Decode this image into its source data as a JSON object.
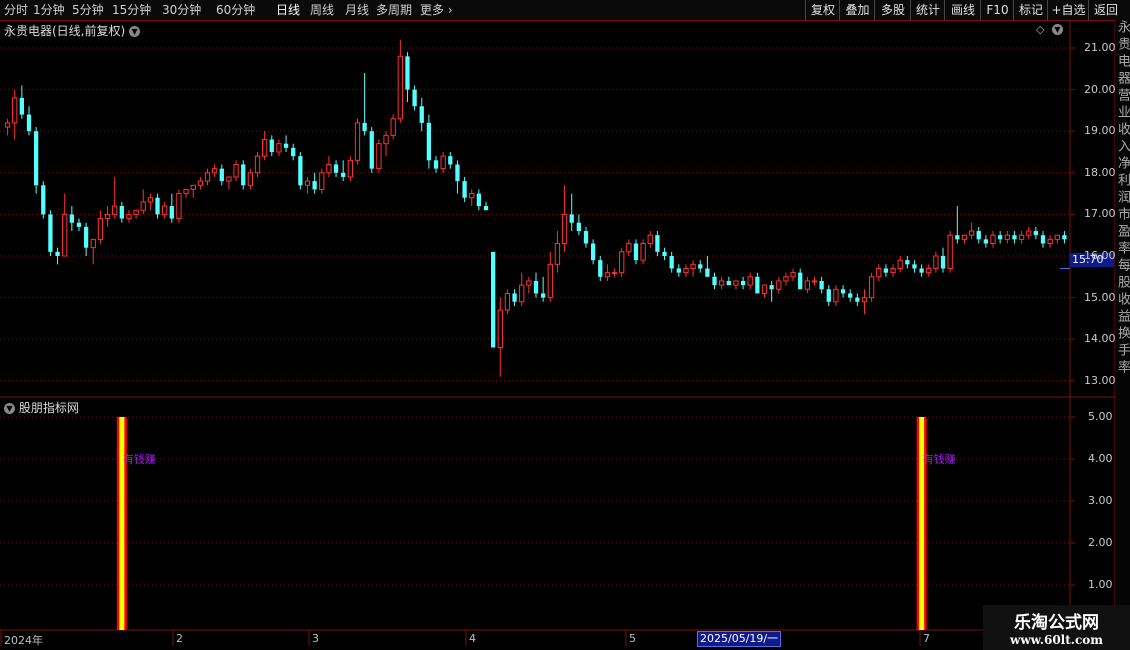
{
  "toolbar": {
    "periods": [
      "分时",
      "1分钟",
      "5分钟",
      "15分钟",
      "30分钟",
      "60分钟",
      "日线",
      "周线",
      "月线",
      "多周期",
      "更多"
    ],
    "active_period": "日线",
    "tools": [
      "复权",
      "叠加",
      "多股",
      "统计",
      "画线",
      "F10",
      "标记",
      "+自选",
      "返回"
    ]
  },
  "main_chart": {
    "title": "永贵电器(日线,前复权)",
    "price_axis": [
      "21.00",
      "20.00",
      "19.00",
      "18.00",
      "17.00",
      "16.00",
      "15.00",
      "14.00",
      "13.00"
    ],
    "current_price": "15.70"
  },
  "indicator": {
    "title": "股朋指标网",
    "axis": [
      "5.00",
      "4.00",
      "3.00",
      "2.00",
      "1.00"
    ],
    "signal_label": "有钱赚"
  },
  "x_axis": {
    "labels": [
      "2024年",
      "2",
      "3",
      "4",
      "5",
      "7"
    ],
    "crosshair_date": "2025/05/19/一"
  },
  "right_strip_text": "永贵电器营业收入净利润市盈率每股收益换手率",
  "watermark": {
    "line1": "乐淘公式网",
    "line2": "www.60lt.com"
  },
  "colors": {
    "up": "#ff3232",
    "down": "#54ffff",
    "grid": "#7a1010",
    "signal": "#ffff00",
    "signal_edge": "#ff0000"
  },
  "chart_data": {
    "type": "candlestick",
    "ylim": [
      12.8,
      21.3
    ],
    "candles": [
      [
        19.1,
        19.3,
        18.9,
        19.2
      ],
      [
        19.2,
        20.0,
        18.8,
        19.8
      ],
      [
        19.8,
        20.1,
        19.3,
        19.4
      ],
      [
        19.4,
        19.6,
        18.9,
        19.0
      ],
      [
        19.0,
        19.1,
        17.5,
        17.7
      ],
      [
        17.7,
        17.8,
        16.9,
        17.0
      ],
      [
        17.0,
        17.1,
        16.0,
        16.1
      ],
      [
        16.1,
        16.2,
        15.8,
        16.0
      ],
      [
        16.0,
        17.5,
        16.0,
        17.0
      ],
      [
        17.0,
        17.2,
        16.6,
        16.8
      ],
      [
        16.8,
        16.9,
        16.6,
        16.7
      ],
      [
        16.7,
        16.8,
        16.0,
        16.2
      ],
      [
        16.2,
        16.3,
        15.8,
        16.4
      ],
      [
        16.4,
        17.1,
        16.3,
        16.9
      ],
      [
        16.9,
        17.2,
        16.7,
        17.0
      ],
      [
        17.0,
        17.9,
        16.9,
        17.2
      ],
      [
        17.2,
        17.3,
        16.8,
        16.9
      ],
      [
        16.9,
        17.1,
        16.8,
        17.0
      ],
      [
        17.0,
        17.1,
        16.9,
        17.1
      ],
      [
        17.1,
        17.6,
        17.0,
        17.3
      ],
      [
        17.3,
        17.5,
        17.1,
        17.4
      ],
      [
        17.4,
        17.5,
        16.9,
        17.0
      ],
      [
        17.0,
        17.3,
        16.9,
        17.2
      ],
      [
        17.2,
        17.5,
        16.8,
        16.9
      ],
      [
        16.9,
        17.6,
        16.8,
        17.5
      ],
      [
        17.5,
        17.6,
        17.4,
        17.6
      ],
      [
        17.6,
        17.7,
        17.4,
        17.7
      ],
      [
        17.7,
        17.9,
        17.6,
        17.8
      ],
      [
        17.8,
        18.1,
        17.7,
        18.0
      ],
      [
        18.0,
        18.2,
        17.9,
        18.1
      ],
      [
        18.1,
        18.2,
        17.7,
        17.8
      ],
      [
        17.8,
        17.9,
        17.6,
        17.9
      ],
      [
        17.9,
        18.3,
        17.8,
        18.2
      ],
      [
        18.2,
        18.3,
        17.6,
        17.7
      ],
      [
        17.7,
        18.1,
        17.6,
        18.0
      ],
      [
        18.0,
        18.5,
        17.9,
        18.4
      ],
      [
        18.4,
        19.0,
        18.3,
        18.8
      ],
      [
        18.8,
        18.9,
        18.4,
        18.5
      ],
      [
        18.5,
        18.8,
        18.4,
        18.7
      ],
      [
        18.7,
        18.9,
        18.5,
        18.6
      ],
      [
        18.6,
        18.7,
        18.3,
        18.4
      ],
      [
        18.4,
        18.5,
        17.6,
        17.7
      ],
      [
        17.7,
        17.9,
        17.5,
        17.8
      ],
      [
        17.8,
        18.0,
        17.5,
        17.6
      ],
      [
        17.6,
        18.1,
        17.5,
        18.0
      ],
      [
        18.0,
        18.4,
        17.9,
        18.2
      ],
      [
        18.2,
        18.3,
        17.9,
        18.0
      ],
      [
        18.0,
        18.3,
        17.8,
        17.9
      ],
      [
        17.9,
        18.4,
        17.8,
        18.3
      ],
      [
        18.3,
        19.3,
        18.2,
        19.2
      ],
      [
        19.2,
        20.4,
        18.9,
        19.0
      ],
      [
        19.0,
        19.1,
        18.0,
        18.1
      ],
      [
        18.1,
        18.8,
        18.0,
        18.7
      ],
      [
        18.7,
        19.0,
        18.4,
        18.9
      ],
      [
        18.9,
        19.4,
        18.8,
        19.3
      ],
      [
        19.3,
        21.2,
        19.2,
        20.8
      ],
      [
        20.8,
        20.9,
        19.7,
        20.0
      ],
      [
        20.0,
        20.1,
        19.5,
        19.6
      ],
      [
        19.6,
        19.8,
        19.0,
        19.2
      ],
      [
        19.2,
        19.4,
        18.1,
        18.3
      ],
      [
        18.3,
        18.4,
        18.0,
        18.1
      ],
      [
        18.1,
        18.5,
        18.0,
        18.4
      ],
      [
        18.4,
        18.5,
        18.1,
        18.2
      ],
      [
        18.2,
        18.3,
        17.5,
        17.8
      ],
      [
        17.8,
        17.9,
        17.3,
        17.4
      ],
      [
        17.4,
        17.6,
        17.2,
        17.5
      ],
      [
        17.5,
        17.6,
        17.1,
        17.2
      ],
      [
        17.2,
        17.3,
        17.1,
        17.1
      ],
      [
        16.1,
        16.1,
        13.8,
        13.8
      ],
      [
        13.8,
        15.0,
        13.1,
        14.7
      ],
      [
        14.7,
        15.2,
        14.6,
        15.1
      ],
      [
        15.1,
        15.2,
        14.8,
        14.9
      ],
      [
        14.9,
        15.6,
        14.8,
        15.3
      ],
      [
        15.3,
        15.5,
        15.1,
        15.4
      ],
      [
        15.4,
        15.6,
        15.0,
        15.1
      ],
      [
        15.1,
        15.5,
        14.9,
        15.0
      ],
      [
        15.0,
        16.1,
        14.9,
        15.8
      ],
      [
        15.8,
        16.6,
        15.6,
        16.3
      ],
      [
        16.3,
        17.7,
        16.1,
        17.0
      ],
      [
        17.0,
        17.5,
        16.6,
        16.8
      ],
      [
        16.8,
        17.0,
        16.5,
        16.6
      ],
      [
        16.6,
        16.7,
        16.2,
        16.3
      ],
      [
        16.3,
        16.4,
        15.8,
        15.9
      ],
      [
        15.9,
        16.0,
        15.4,
        15.5
      ],
      [
        15.5,
        15.8,
        15.4,
        15.6
      ],
      [
        15.6,
        15.7,
        15.5,
        15.6
      ],
      [
        15.6,
        16.2,
        15.5,
        16.1
      ],
      [
        16.1,
        16.4,
        16.0,
        16.3
      ],
      [
        16.3,
        16.4,
        15.8,
        15.9
      ],
      [
        15.9,
        16.4,
        15.8,
        16.3
      ],
      [
        16.3,
        16.6,
        16.2,
        16.5
      ],
      [
        16.5,
        16.6,
        16.0,
        16.1
      ],
      [
        16.1,
        16.2,
        15.9,
        16.0
      ],
      [
        16.0,
        16.1,
        15.6,
        15.7
      ],
      [
        15.7,
        15.8,
        15.5,
        15.6
      ],
      [
        15.6,
        15.8,
        15.5,
        15.7
      ],
      [
        15.7,
        15.9,
        15.5,
        15.8
      ],
      [
        15.8,
        15.9,
        15.6,
        15.7
      ],
      [
        15.7,
        16.0,
        15.5,
        15.5
      ],
      [
        15.5,
        15.6,
        15.2,
        15.3
      ],
      [
        15.3,
        15.5,
        15.2,
        15.4
      ],
      [
        15.4,
        15.5,
        15.3,
        15.3
      ],
      [
        15.3,
        15.4,
        15.2,
        15.4
      ],
      [
        15.4,
        15.5,
        15.2,
        15.3
      ],
      [
        15.3,
        15.6,
        15.2,
        15.5
      ],
      [
        15.5,
        15.6,
        15.1,
        15.1
      ],
      [
        15.1,
        15.3,
        15.0,
        15.3
      ],
      [
        15.3,
        15.4,
        14.9,
        15.2
      ],
      [
        15.2,
        15.5,
        15.1,
        15.4
      ],
      [
        15.4,
        15.6,
        15.3,
        15.5
      ],
      [
        15.5,
        15.7,
        15.4,
        15.6
      ],
      [
        15.6,
        15.7,
        15.2,
        15.2
      ],
      [
        15.2,
        15.5,
        15.1,
        15.4
      ],
      [
        15.4,
        15.5,
        15.3,
        15.4
      ],
      [
        15.4,
        15.5,
        15.1,
        15.2
      ],
      [
        15.2,
        15.3,
        14.8,
        14.9
      ],
      [
        14.9,
        15.3,
        14.8,
        15.2
      ],
      [
        15.2,
        15.3,
        15.0,
        15.1
      ],
      [
        15.1,
        15.2,
        14.9,
        15.0
      ],
      [
        15.0,
        15.1,
        14.8,
        14.9
      ],
      [
        14.9,
        15.2,
        14.6,
        15.0
      ],
      [
        15.0,
        15.6,
        14.9,
        15.5
      ],
      [
        15.5,
        15.8,
        15.4,
        15.7
      ],
      [
        15.7,
        15.8,
        15.5,
        15.6
      ],
      [
        15.6,
        15.8,
        15.5,
        15.7
      ],
      [
        15.7,
        16.0,
        15.6,
        15.9
      ],
      [
        15.9,
        16.0,
        15.7,
        15.8
      ],
      [
        15.8,
        15.9,
        15.6,
        15.7
      ],
      [
        15.7,
        15.8,
        15.5,
        15.6
      ],
      [
        15.6,
        15.8,
        15.5,
        15.7
      ],
      [
        15.7,
        16.1,
        15.6,
        16.0
      ],
      [
        16.0,
        16.2,
        15.6,
        15.7
      ],
      [
        15.7,
        16.6,
        15.6,
        16.5
      ],
      [
        16.5,
        17.2,
        16.3,
        16.4
      ],
      [
        16.4,
        16.5,
        16.3,
        16.5
      ],
      [
        16.5,
        16.8,
        16.4,
        16.6
      ],
      [
        16.6,
        16.7,
        16.3,
        16.4
      ],
      [
        16.4,
        16.5,
        16.2,
        16.3
      ],
      [
        16.3,
        16.6,
        16.2,
        16.5
      ],
      [
        16.5,
        16.6,
        16.3,
        16.4
      ],
      [
        16.4,
        16.6,
        16.3,
        16.5
      ],
      [
        16.5,
        16.6,
        16.3,
        16.4
      ],
      [
        16.4,
        16.6,
        16.3,
        16.5
      ],
      [
        16.5,
        16.7,
        16.4,
        16.6
      ],
      [
        16.6,
        16.7,
        16.4,
        16.5
      ],
      [
        16.5,
        16.6,
        16.2,
        16.3
      ],
      [
        16.3,
        16.5,
        16.2,
        16.4
      ],
      [
        16.4,
        16.5,
        16.3,
        16.5
      ],
      [
        16.5,
        16.6,
        16.3,
        16.4
      ]
    ],
    "signal_bars": [
      16,
      128
    ],
    "signal_value": 5.0
  }
}
